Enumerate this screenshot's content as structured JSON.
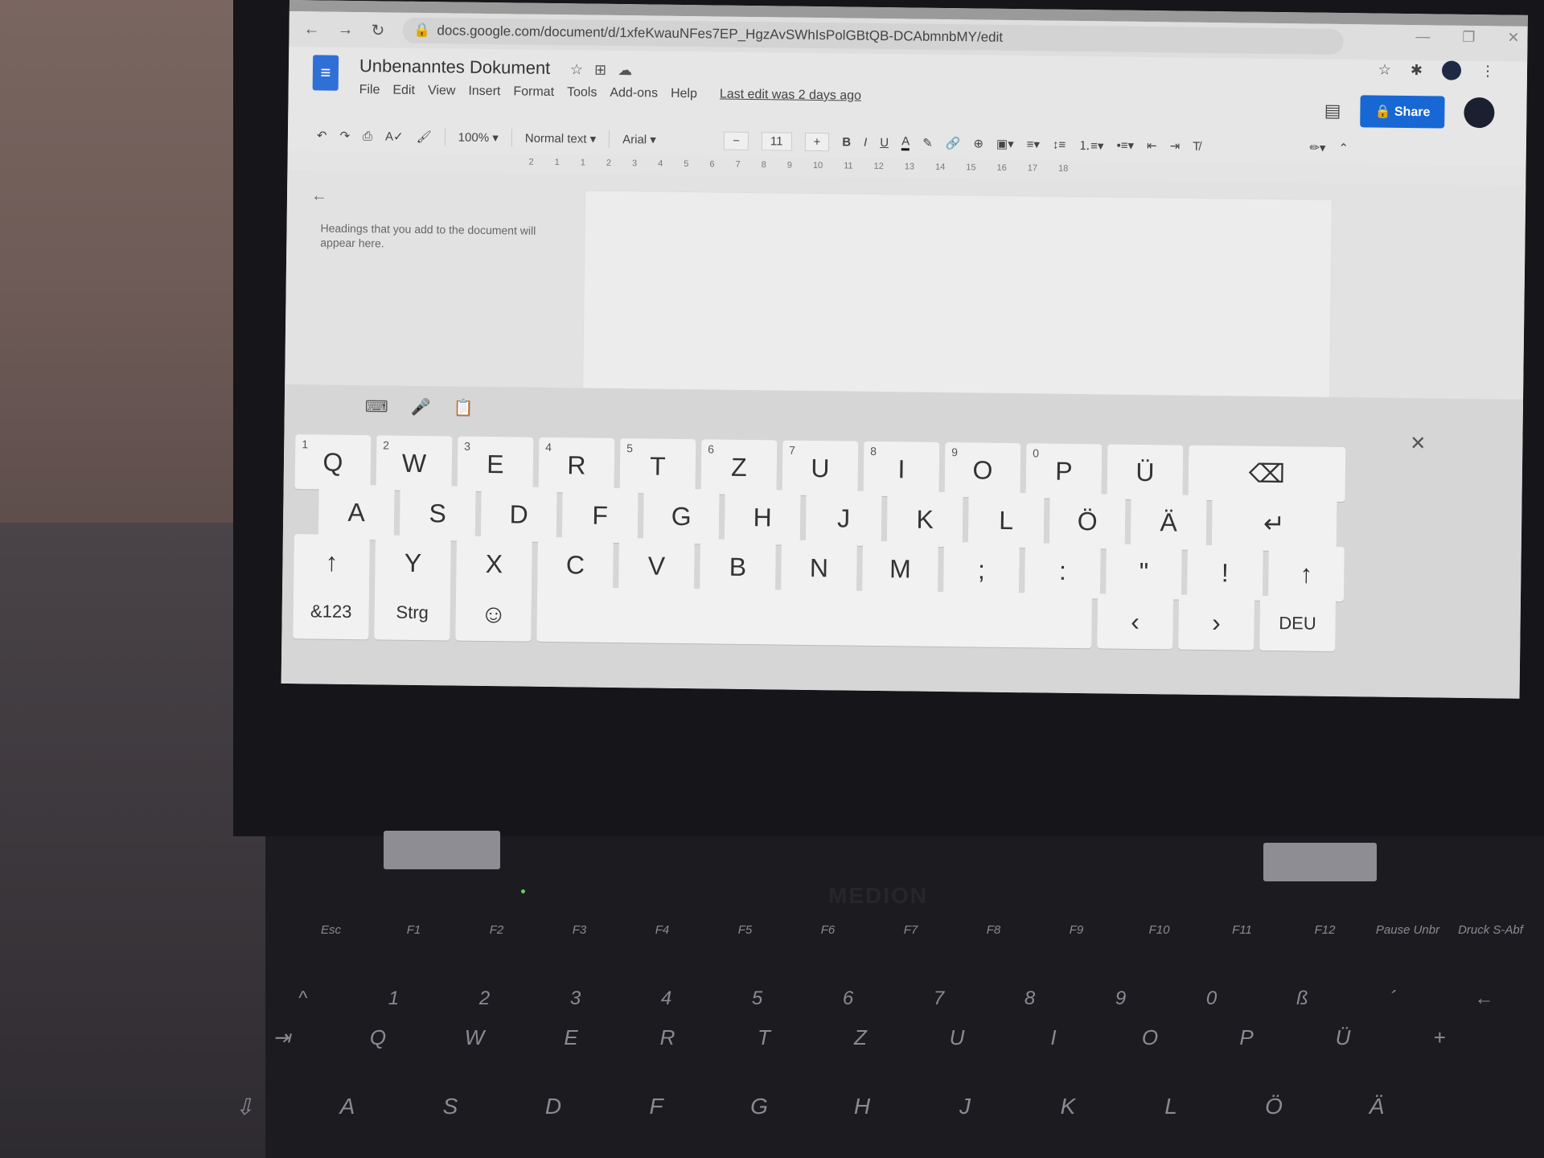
{
  "browser": {
    "url": "docs.google.com/document/d/1xfeKwauNFes7EP_HgzAvSWhIsPolGBtQB-DCAbmnbMY/edit",
    "nav": [
      "←",
      "→",
      "↻"
    ],
    "window_controls": [
      "—",
      "❐",
      "✕"
    ]
  },
  "docs": {
    "title": "Unbenanntes Dokument",
    "menu": [
      "File",
      "Edit",
      "View",
      "Insert",
      "Format",
      "Tools",
      "Add-ons",
      "Help"
    ],
    "last_edit": "Last edit was 2 days ago",
    "share_label": "Share",
    "toolbar": {
      "zoom": "100%",
      "style": "Normal text",
      "font": "Arial",
      "font_size": "11",
      "bold": "B",
      "italic": "I",
      "underline": "U",
      "text_color": "A"
    },
    "ruler": [
      "2",
      "1",
      "1",
      "2",
      "3",
      "4",
      "5",
      "6",
      "7",
      "8",
      "9",
      "10",
      "11",
      "12",
      "13",
      "14",
      "15",
      "16",
      "17",
      "18"
    ],
    "outline_hint": "Headings that you add to the document will appear here.",
    "accent": "#1767d4"
  },
  "onscreen_keyboard": {
    "rows": [
      [
        {
          "l": "Q",
          "n": "1"
        },
        {
          "l": "W",
          "n": "2"
        },
        {
          "l": "E",
          "n": "3"
        },
        {
          "l": "R",
          "n": "4"
        },
        {
          "l": "T",
          "n": "5"
        },
        {
          "l": "Z",
          "n": "6"
        },
        {
          "l": "U",
          "n": "7"
        },
        {
          "l": "I",
          "n": "8"
        },
        {
          "l": "O",
          "n": "9"
        },
        {
          "l": "P",
          "n": "0"
        },
        {
          "l": "Ü"
        },
        {
          "l": "⌫",
          "w": 2
        }
      ],
      [
        {
          "l": "A"
        },
        {
          "l": "S"
        },
        {
          "l": "D"
        },
        {
          "l": "F"
        },
        {
          "l": "G"
        },
        {
          "l": "H"
        },
        {
          "l": "J"
        },
        {
          "l": "K"
        },
        {
          "l": "L"
        },
        {
          "l": "Ö"
        },
        {
          "l": "Ä"
        },
        {
          "l": "↵",
          "w": 1.6
        }
      ],
      [
        {
          "l": "↑"
        },
        {
          "l": "Y"
        },
        {
          "l": "X"
        },
        {
          "l": "C"
        },
        {
          "l": "V"
        },
        {
          "l": "B"
        },
        {
          "l": "N"
        },
        {
          "l": "M"
        },
        {
          "l": ";"
        },
        {
          "l": ":"
        },
        {
          "l": "\""
        },
        {
          "l": "!"
        },
        {
          "l": "↑"
        }
      ],
      [
        {
          "l": "&123",
          "s": 1
        },
        {
          "l": "Strg",
          "s": 1
        },
        {
          "l": "☺"
        },
        {
          "l": "",
          "w": 6.9
        },
        {
          "l": "‹"
        },
        {
          "l": "›"
        },
        {
          "l": "DEU",
          "s": 1
        }
      ]
    ]
  },
  "laptop": {
    "brand": "MEDION",
    "keys": [
      [
        "Esc",
        "F1",
        "F2",
        "F3",
        "F4",
        "F5",
        "F6",
        "F7",
        "F8",
        "F9",
        "F10",
        "F11",
        "F12",
        "Pause Unbr",
        "Druck S-Abf"
      ],
      [
        "^",
        "1",
        "2",
        "3",
        "4",
        "5",
        "6",
        "7",
        "8",
        "9",
        "0",
        "ß",
        "´",
        "←"
      ],
      [
        "⇥",
        "Q",
        "W",
        "E",
        "R",
        "T",
        "Z",
        "U",
        "I",
        "O",
        "P",
        "Ü",
        "+"
      ],
      [
        "⇩",
        "A",
        "S",
        "D",
        "F",
        "G",
        "H",
        "J",
        "K",
        "L",
        "Ö",
        "Ä"
      ]
    ]
  }
}
